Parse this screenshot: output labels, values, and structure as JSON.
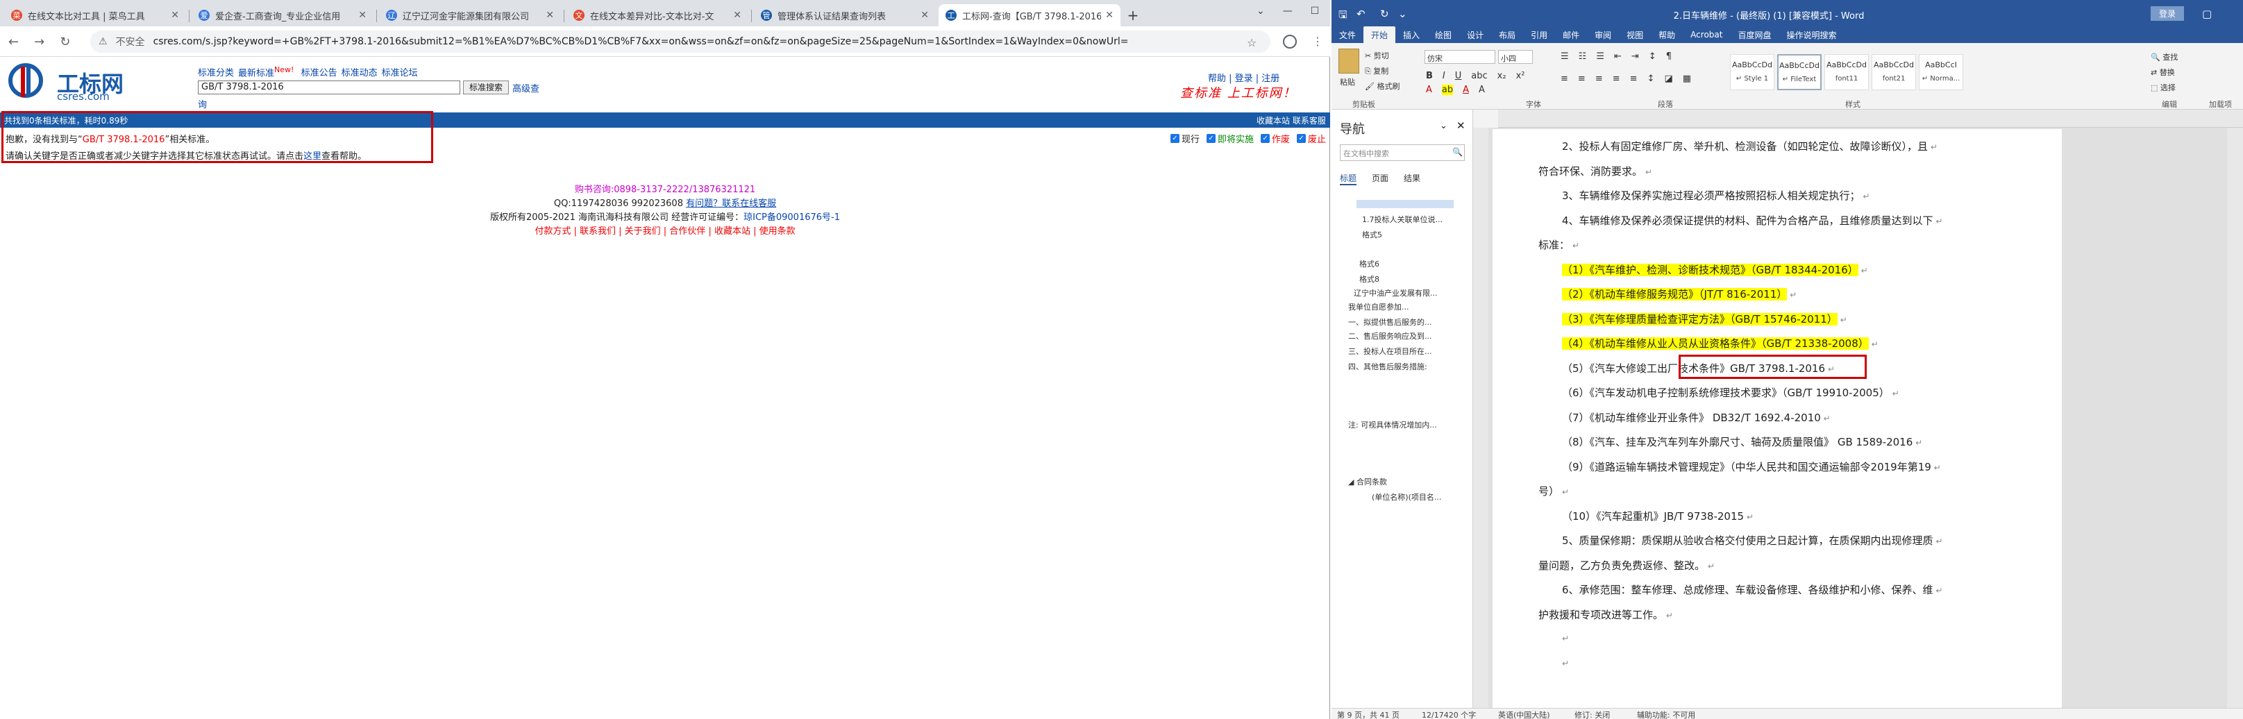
{
  "browser": {
    "tabs": [
      {
        "label": "在线文本比对工具 | 菜鸟工具",
        "fav": "#e34a2f"
      },
      {
        "label": "爱企查-工商查询_专业企业信用",
        "fav": "#3a78d8"
      },
      {
        "label": "辽宁辽河金宇能源集团有限公司",
        "fav": "#3a78d8"
      },
      {
        "label": "在线文本差异对比-文本比对-文",
        "fav": "#e34a2f"
      },
      {
        "label": "管理体系认证结果查询列表",
        "fav": "#1a5ba8"
      },
      {
        "label": "工标网-查询【GB/T 3798.1-2016】",
        "fav": "#1a5ba8"
      }
    ],
    "address": {
      "not_secure": "不安全",
      "url": "csres.com/s.jsp?keyword=+GB%2FT+3798.1-2016&submit12=%B1%EA%D7%BC%CB%D1%CB%F7&xx=on&wss=on&zf=on&fz=on&pageSize=25&pageNum=1&SortIndex=1&WayIndex=0&nowUrl="
    }
  },
  "site": {
    "logo_name": "工标网",
    "logo_domain": "csres.com",
    "nav": [
      "标准分类",
      "最新标准",
      "标准公告",
      "标准动态",
      "标准论坛"
    ],
    "new_tag": "New!",
    "search_value": "GB/T 3798.1-2016",
    "search_button": "标准搜索",
    "advanced": "高级查",
    "advanced2": "询",
    "right_links": "帮助 | 登录 | 注册",
    "slogan": "查标准 上工标网！",
    "bar_left": "共找到0条相关标准，耗时0.89秒",
    "bar_right": "收藏本站  联系客服",
    "msg1_a": "抱歉，没有找到与“",
    "msg1_kw": "GB/T 3798.1-2016",
    "msg1_b": "”相关标准。",
    "msg2_a": "请确认关键字是否正确或者减少关键字并选择其它标准状态再试试。请点击",
    "msg2_link": "这里",
    "msg2_b": "查看帮助。",
    "filters": [
      "现行",
      "即将实施",
      "作废",
      "废止"
    ],
    "footer_phone": "购书咨询:0898-3137-2222/13876321121",
    "footer_qq": "QQ:1197428036 992023608",
    "footer_qq_link": "有问题？联系在线客服",
    "footer_copy": "版权所有2005-2021 海南讯海科技有限公司 经营许可证编号：",
    "footer_icp": "琼ICP备09001676号-1",
    "footer_links": "付款方式 | 联系我们 | 关于我们 | 合作伙伴 | 收藏本站 | 使用条款"
  },
  "word": {
    "title": "2.日车辆维修 - (最终版) (1) [兼容模式] - Word",
    "login": "登录",
    "tabs": [
      "文件",
      "开始",
      "插入",
      "绘图",
      "设计",
      "布局",
      "引用",
      "邮件",
      "审阅",
      "视图",
      "帮助",
      "Acrobat",
      "百度网盘",
      "操作说明搜索"
    ],
    "ribbon": {
      "clipboard": "剪贴板",
      "paste": "粘贴",
      "cut": "剪切",
      "copy": "复制",
      "painter": "格式刷",
      "font_name": "仿宋",
      "font_size": "小四",
      "font": "字体",
      "paragraph": "段落",
      "styles": "样式",
      "editing": "编辑",
      "find": "查找",
      "replace": "替换",
      "select": "选择",
      "addins": "加载项",
      "style_boxes": [
        {
          "s": "AaBbCcDd",
          "n": "↵ Style 1"
        },
        {
          "s": "AaBbCcDd",
          "n": "↵ FileText"
        },
        {
          "s": "AaBbCcDd",
          "n": "font11"
        },
        {
          "s": "AaBbCcDd",
          "n": "font21"
        },
        {
          "s": "AaBbCcI",
          "n": "↵ Norma..."
        }
      ]
    },
    "nav": {
      "title": "导航",
      "search_placeholder": "在文档中搜索",
      "tabs": [
        "标题",
        "页面",
        "结果"
      ],
      "items": [
        "1.7投标人关联单位说...",
        "格式5",
        "格式6",
        "格式8",
        "辽宁中油产业发展有限...",
        "我单位自愿参加...",
        "一、拟提供售后服务的...",
        "二、售后服务响应及到...",
        "三、投标人在项目所在...",
        "四、其他售后服务措施:",
        "注: 可视具体情况增加内...",
        "合同条款",
        "(单位名称)(项目名..."
      ]
    },
    "doc": [
      {
        "t": "2、投标人有固定维修厂房、举升机、检测设备（如四轮定位、故障诊断仪），且",
        "hl": false
      },
      {
        "t": "符合环保、消防要求。",
        "hl": false
      },
      {
        "t": "3、车辆维修及保养实施过程必须严格按照招标人相关规定执行；",
        "hl": false
      },
      {
        "t": "4、车辆维修及保养必须保证提供的材料、配件为合格产品，且维修质量达到以下",
        "hl": false
      },
      {
        "t": "标准：",
        "hl": false
      },
      {
        "t": "（1）《汽车维护、检测、诊断技术规范》（GB/T 18344-2016）",
        "hl": true
      },
      {
        "t": "（2）《机动车维修服务规范》（JT/T 816-2011）",
        "hl": true
      },
      {
        "t": "（3）《汽车修理质量检查评定方法》（GB/T 15746-2011）",
        "hl": true
      },
      {
        "t": "（4）《机动车维修从业人员从业资格条件》（GB/T 21338-2008）",
        "hl": true
      },
      {
        "t": "（5）《汽车大修竣工出厂技术条件》GB/T 3798.1-2016",
        "hl": false
      },
      {
        "t": "（6）《汽车发动机电子控制系统修理技术要求》（GB/T 19910-2005）",
        "hl": false
      },
      {
        "t": "（7）《机动车维修业开业条件》 DB32/T 1692.4-2010",
        "hl": false
      },
      {
        "t": "（8）《汽车、挂车及汽车列车外廓尺寸、轴荷及质量限值》 GB 1589-2016",
        "hl": false
      },
      {
        "t": "（9）《道路运输车辆技术管理规定》（中华人民共和国交通运输部令2019年第19",
        "hl": false
      },
      {
        "t": "号）",
        "hl": false
      },
      {
        "t": "（10）《汽车起重机》JB/T 9738-2015",
        "hl": false
      },
      {
        "t": "5、质量保修期：质保期从验收合格交付使用之日起计算，在质保期内出现修理质",
        "hl": false
      },
      {
        "t": "量问题，乙方负责免费返修、整改。",
        "hl": false
      },
      {
        "t": "6、承修范围：整车修理、总成修理、车载设备修理、各级维护和小修、保养、维",
        "hl": false
      },
      {
        "t": "护救援和专项改进等工作。",
        "hl": false
      },
      {
        "t": "",
        "hl": false
      },
      {
        "t": "",
        "hl": false
      }
    ],
    "status": {
      "page": "第 9 页，共 41 页",
      "words": "12/17420 个字",
      "lang": "英语(中国大陆)",
      "track": "修订: 关闭",
      "access": "辅助功能: 不可用"
    }
  }
}
